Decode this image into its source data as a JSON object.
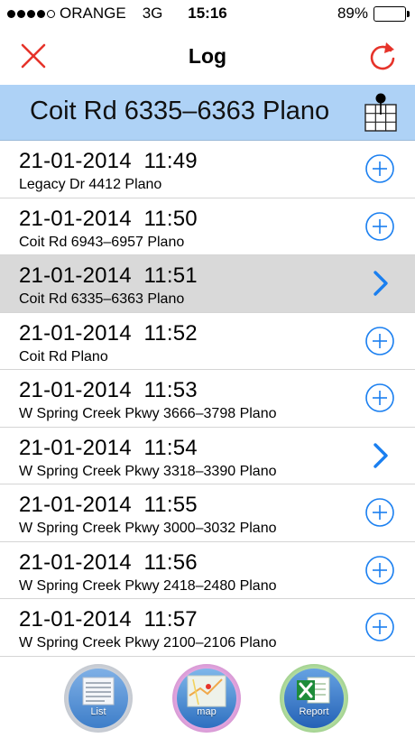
{
  "status_bar": {
    "carrier": "ORANGE",
    "network": "3G",
    "time": "15:16",
    "battery": "89%",
    "battery_level": 0.89,
    "signal_bars_filled": 4,
    "signal_bars_total": 5
  },
  "nav": {
    "title": "Log",
    "close_icon": "close-x-icon",
    "refresh_icon": "refresh-icon"
  },
  "header": {
    "title": "Coit Rd 6335–6363 Plano",
    "icon": "map-grid-pin-icon"
  },
  "log": [
    {
      "date": "21-01-2014",
      "time": "11:49",
      "address": "Legacy Dr 4412 Plano",
      "action": "plus-circle-icon",
      "selected": false
    },
    {
      "date": "21-01-2014",
      "time": "11:50",
      "address": "Coit Rd 6943–6957 Plano",
      "action": "plus-circle-icon",
      "selected": false
    },
    {
      "date": "21-01-2014",
      "time": "11:51",
      "address": "Coit Rd 6335–6363 Plano",
      "action": "chevron-right-icon",
      "selected": true
    },
    {
      "date": "21-01-2014",
      "time": "11:52",
      "address": "Coit Rd  Plano",
      "action": "plus-circle-icon",
      "selected": false
    },
    {
      "date": "21-01-2014",
      "time": "11:53",
      "address": "W Spring Creek Pkwy 3666–3798 Plano",
      "action": "plus-circle-icon",
      "selected": false
    },
    {
      "date": "21-01-2014",
      "time": "11:54",
      "address": "W Spring Creek Pkwy 3318–3390 Plano",
      "action": "chevron-right-icon",
      "selected": false
    },
    {
      "date": "21-01-2014",
      "time": "11:55",
      "address": "W Spring Creek Pkwy 3000–3032 Plano",
      "action": "plus-circle-icon",
      "selected": false
    },
    {
      "date": "21-01-2014",
      "time": "11:56",
      "address": "W Spring Creek Pkwy 2418–2480 Plano",
      "action": "plus-circle-icon",
      "selected": false
    },
    {
      "date": "21-01-2014",
      "time": "11:57",
      "address": "W Spring Creek Pkwy 2100–2106 Plano",
      "action": "plus-circle-icon",
      "selected": false
    }
  ],
  "tabs": {
    "list": "List",
    "map": "map",
    "report": "Report"
  },
  "colors": {
    "accent_red": "#e6332a",
    "accent_blue": "#1a7ff0",
    "header_bg": "#aed2f6",
    "selected_row_bg": "#d9d9d9"
  }
}
